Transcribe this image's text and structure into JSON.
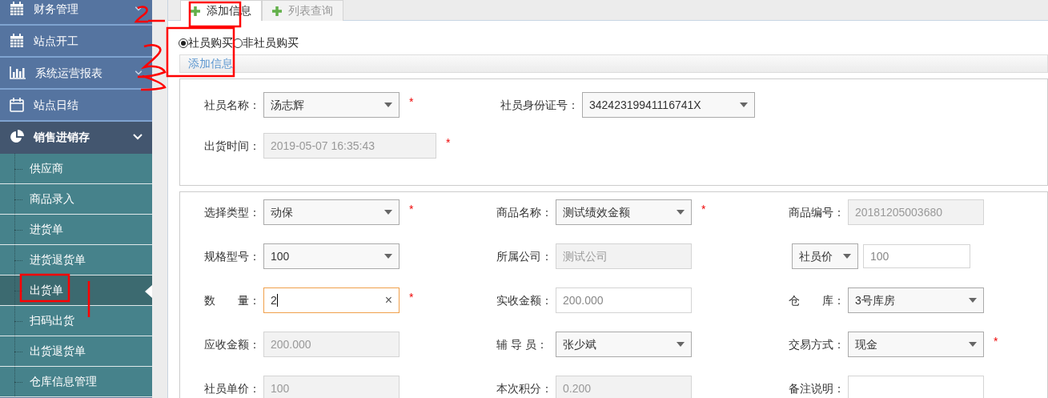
{
  "sidebar": {
    "items": [
      {
        "label": "财务管理",
        "expanded": false
      },
      {
        "label": "站点开工"
      },
      {
        "label": "系统运营报表",
        "expanded": false
      },
      {
        "label": "站点日结"
      },
      {
        "label": "销售进销存",
        "expanded": true,
        "children": [
          {
            "label": "供应商",
            "selected": false
          },
          {
            "label": "商品录入",
            "selected": false
          },
          {
            "label": "进货单",
            "selected": false
          },
          {
            "label": "进货退货单",
            "selected": false
          },
          {
            "label": "出货单",
            "selected": true
          },
          {
            "label": "扫码出货",
            "selected": false
          },
          {
            "label": "出货退货单",
            "selected": false
          },
          {
            "label": "仓库信息管理",
            "selected": false
          }
        ]
      }
    ]
  },
  "tabs": [
    {
      "label": "添加信息",
      "selected": true
    },
    {
      "label": "列表查询",
      "selected": false
    }
  ],
  "buyer_type": [
    {
      "label": "社员购买",
      "selected": true
    },
    {
      "label": "非社员购买",
      "selected": false
    }
  ],
  "section_link": "添加信息",
  "panels": [
    {
      "rows": [
        [
          {
            "label": "社员名称：",
            "kind": "select",
            "value": "汤志辉",
            "required_mark": "*"
          },
          {
            "label": "社员身份证号：",
            "kind": "select",
            "value": "34242319941116741X"
          }
        ],
        [
          {
            "label": "出货时间：",
            "kind": "readonly",
            "value": "2019-05-07 16:35:43",
            "required_mark": "*"
          }
        ]
      ]
    },
    {
      "rows": [
        [
          {
            "label": "选择类型：",
            "kind": "select",
            "value": "动保",
            "required_mark": "*"
          },
          {
            "label": "商品名称：",
            "kind": "select",
            "value": "测试绩效金额",
            "required_mark": "*"
          },
          {
            "label": "商品编号：",
            "kind": "readonly",
            "value": "20181205003680"
          }
        ],
        [
          {
            "label": "规格型号：",
            "kind": "select",
            "value": "100"
          },
          {
            "label": "所属公司：",
            "kind": "readonly",
            "value": "测试公司"
          },
          {
            "kind": "price",
            "option": "社员价",
            "value": "100"
          }
        ],
        [
          {
            "label": "数　　量：",
            "kind": "focused",
            "value": "2",
            "clear": "×",
            "required_mark": "*"
          },
          {
            "label": "实收金额：",
            "kind": "text",
            "value": "200.000"
          },
          {
            "label": "仓　　库：",
            "kind": "select",
            "value": "3号库房"
          }
        ],
        [
          {
            "label": "应收金额：",
            "kind": "readonly",
            "value": "200.000"
          },
          {
            "label": "辅 导 员：",
            "kind": "select",
            "value": "张少斌"
          },
          {
            "label": "交易方式：",
            "kind": "select",
            "value": "现金",
            "required_mark": "*"
          }
        ],
        [
          {
            "label": "社员单价：",
            "kind": "readonly",
            "value": "100"
          },
          {
            "label": "本次积分：",
            "kind": "readonly",
            "value": "0.200"
          },
          {
            "label": "备注说明：",
            "kind": "text"
          }
        ]
      ]
    }
  ]
}
